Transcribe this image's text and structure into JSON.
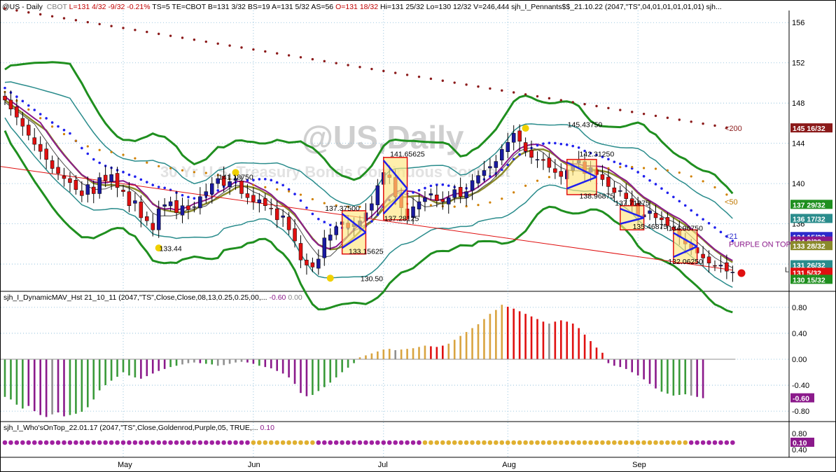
{
  "header": {
    "symbol": "@US - Daily",
    "exchange": "CBOT",
    "stats": [
      {
        "text": "L=131 4/32",
        "color": "r"
      },
      {
        "text": "-9/32",
        "color": "r"
      },
      {
        "text": "-0.21%",
        "color": "r"
      },
      {
        "text": "TS=5",
        "color": "k"
      },
      {
        "text": "TE=CBOT",
        "color": "k"
      },
      {
        "text": "B=131 3/32",
        "color": "k"
      },
      {
        "text": "BS=19",
        "color": "k"
      },
      {
        "text": "A=131 5/32",
        "color": "k"
      },
      {
        "text": "AS=56",
        "color": "k"
      },
      {
        "text": "O=131 18/32",
        "color": "r"
      },
      {
        "text": "Hi=131 25/32",
        "color": "k"
      },
      {
        "text": "Lo=130 12/32",
        "color": "k"
      },
      {
        "text": "V=246,444",
        "color": "k"
      },
      {
        "text": "sjh_I_Pennants$$_21.10.22 (2047,\"TS\",04,01,01,01,01,01)",
        "color": "k"
      },
      {
        "text": "sjh...",
        "color": "k"
      }
    ]
  },
  "watermark": {
    "title": "@US,Daily",
    "subtitle": "30 Yr U.S. Treasury Bonds Continuous Contract"
  },
  "panel2_header": {
    "name": "sjh_I_DynamicMAV_Hst 21_10_11 (2047,\"TS\",Close,Close,08,13,0.25,0.25,00,...",
    "v1": "-0.60",
    "v2": "0.00"
  },
  "panel3_header": {
    "name": "sjh_I_Who'sOnTop_22.01.17 (2047,\"TS\",Close,Goldenrod,Purple,05, TRUE,...",
    "v1": "0.10"
  },
  "chart_data": {
    "type": "candlestick",
    "price_axis": {
      "range": [
        129.5,
        157.2
      ],
      "ticks": [
        156,
        152,
        148,
        144,
        140,
        136,
        132
      ]
    },
    "histogram_axis": {
      "range": [
        -0.95,
        0.95
      ],
      "ticks": [
        "0.80",
        "0.40",
        "0.00",
        "-0.40",
        "-0.80"
      ]
    },
    "dots_axis": {
      "ticks": [
        "0.80",
        "0.40"
      ]
    },
    "x_labels": [
      {
        "label": "May",
        "index": 20
      },
      {
        "label": "Jun",
        "index": 42
      },
      {
        "label": "Jul",
        "index": 64
      },
      {
        "label": "Aug",
        "index": 85
      },
      {
        "label": "Sep",
        "index": 107
      }
    ],
    "closes": [
      148.3,
      147.4,
      146.6,
      145.7,
      144.8,
      143.9,
      143.2,
      142.4,
      141.5,
      141.0,
      140.5,
      140.1,
      139.4,
      138.8,
      139.9,
      139.0,
      140.6,
      140.3,
      140.9,
      139.6,
      139.2,
      137.8,
      138.3,
      136.6,
      136.3,
      135.4,
      137.5,
      137.9,
      138.2,
      137.1,
      137.8,
      137.4,
      137.7,
      138.7,
      139.2,
      140.0,
      140.5,
      139.8,
      140.2,
      140.5,
      139.0,
      138.6,
      138.2,
      138.4,
      137.8,
      137.5,
      136.4,
      136.8,
      135.4,
      134.3,
      132.4,
      131.9,
      131.7,
      132.5,
      134.6,
      134.9,
      135.7,
      136.2,
      135.6,
      136.0,
      136.3,
      137.1,
      138.0,
      139.8,
      141.1,
      140.6,
      138.7,
      137.6,
      136.5,
      137.7,
      138.2,
      138.6,
      139.0,
      138.3,
      138.2,
      138.6,
      139.4,
      138.7,
      139.2,
      140.3,
      140.8,
      141.3,
      141.7,
      142.2,
      143.4,
      144.1,
      145.0,
      144.2,
      143.2,
      142.6,
      142.4,
      142.3,
      141.6,
      141.1,
      140.7,
      141.3,
      141.8,
      142.3,
      141.0,
      141.6,
      140.9,
      140.4,
      139.7,
      139.1,
      139.3,
      138.5,
      137.8,
      136.8,
      136.9,
      137.3,
      136.6,
      136.4,
      135.8,
      135.4,
      134.7,
      134.0,
      133.4,
      133.1,
      132.6,
      132.1,
      131.8,
      131.9,
      131.3,
      131.2
    ],
    "histogram": [
      {
        "v": -0.58,
        "c": "g"
      },
      {
        "v": -0.62,
        "c": "g"
      },
      {
        "v": -0.7,
        "c": "g"
      },
      {
        "v": -0.76,
        "c": "g"
      },
      {
        "v": -0.72,
        "c": "p"
      },
      {
        "v": -0.8,
        "c": "p"
      },
      {
        "v": -0.86,
        "c": "p"
      },
      {
        "v": -0.89,
        "c": "p"
      },
      {
        "v": -0.85,
        "c": "x"
      },
      {
        "v": -0.82,
        "c": "p"
      },
      {
        "v": -0.88,
        "c": "p"
      },
      {
        "v": -0.86,
        "c": "g"
      },
      {
        "v": -0.84,
        "c": "g"
      },
      {
        "v": -0.81,
        "c": "g"
      },
      {
        "v": -0.74,
        "c": "g"
      },
      {
        "v": -0.62,
        "c": "g"
      },
      {
        "v": -0.48,
        "c": "g"
      },
      {
        "v": -0.4,
        "c": "g"
      },
      {
        "v": -0.33,
        "c": "g"
      },
      {
        "v": -0.27,
        "c": "g"
      },
      {
        "v": -0.2,
        "c": "g"
      },
      {
        "v": -0.25,
        "c": "g"
      },
      {
        "v": -0.28,
        "c": "g"
      },
      {
        "v": -0.3,
        "c": "p"
      },
      {
        "v": -0.26,
        "c": "p"
      },
      {
        "v": -0.22,
        "c": "p"
      },
      {
        "v": -0.18,
        "c": "p"
      },
      {
        "v": -0.15,
        "c": "p"
      },
      {
        "v": -0.12,
        "c": "g"
      },
      {
        "v": -0.1,
        "c": "g"
      },
      {
        "v": -0.08,
        "c": "x"
      },
      {
        "v": -0.06,
        "c": "x"
      },
      {
        "v": -0.05,
        "c": "x"
      },
      {
        "v": -0.06,
        "c": "p"
      },
      {
        "v": -0.07,
        "c": "g"
      },
      {
        "v": -0.08,
        "c": "g"
      },
      {
        "v": -0.1,
        "c": "x"
      },
      {
        "v": -0.09,
        "c": "x"
      },
      {
        "v": -0.07,
        "c": "x"
      },
      {
        "v": -0.05,
        "c": "x"
      },
      {
        "v": -0.04,
        "c": "x"
      },
      {
        "v": -0.05,
        "c": "p"
      },
      {
        "v": -0.07,
        "c": "p"
      },
      {
        "v": -0.1,
        "c": "g"
      },
      {
        "v": -0.12,
        "c": "p"
      },
      {
        "v": -0.14,
        "c": "p"
      },
      {
        "v": -0.18,
        "c": "p"
      },
      {
        "v": -0.22,
        "c": "p"
      },
      {
        "v": -0.28,
        "c": "p"
      },
      {
        "v": -0.38,
        "c": "p"
      },
      {
        "v": -0.52,
        "c": "p"
      },
      {
        "v": -0.57,
        "c": "p"
      },
      {
        "v": -0.55,
        "c": "g"
      },
      {
        "v": -0.49,
        "c": "g"
      },
      {
        "v": -0.43,
        "c": "g"
      },
      {
        "v": -0.36,
        "c": "g"
      },
      {
        "v": -0.28,
        "c": "g"
      },
      {
        "v": -0.2,
        "c": "g"
      },
      {
        "v": -0.13,
        "c": "g"
      },
      {
        "v": -0.06,
        "c": "g"
      },
      {
        "v": 0.03,
        "c": "o"
      },
      {
        "v": 0.06,
        "c": "o"
      },
      {
        "v": 0.09,
        "c": "o"
      },
      {
        "v": 0.12,
        "c": "o"
      },
      {
        "v": 0.15,
        "c": "o"
      },
      {
        "v": 0.16,
        "c": "o"
      },
      {
        "v": 0.14,
        "c": "x"
      },
      {
        "v": 0.15,
        "c": "o"
      },
      {
        "v": 0.16,
        "c": "o"
      },
      {
        "v": 0.17,
        "c": "o"
      },
      {
        "v": 0.19,
        "c": "o"
      },
      {
        "v": 0.21,
        "c": "o"
      },
      {
        "v": 0.2,
        "c": "r"
      },
      {
        "v": 0.19,
        "c": "r"
      },
      {
        "v": 0.21,
        "c": "r"
      },
      {
        "v": 0.24,
        "c": "o"
      },
      {
        "v": 0.3,
        "c": "o"
      },
      {
        "v": 0.36,
        "c": "o"
      },
      {
        "v": 0.42,
        "c": "o"
      },
      {
        "v": 0.48,
        "c": "o"
      },
      {
        "v": 0.54,
        "c": "o"
      },
      {
        "v": 0.62,
        "c": "o"
      },
      {
        "v": 0.7,
        "c": "o"
      },
      {
        "v": 0.76,
        "c": "o"
      },
      {
        "v": 0.84,
        "c": "o"
      },
      {
        "v": 0.81,
        "c": "r"
      },
      {
        "v": 0.78,
        "c": "r"
      },
      {
        "v": 0.74,
        "c": "r"
      },
      {
        "v": 0.7,
        "c": "r"
      },
      {
        "v": 0.66,
        "c": "r"
      },
      {
        "v": 0.62,
        "c": "r"
      },
      {
        "v": 0.58,
        "c": "r"
      },
      {
        "v": 0.55,
        "c": "x"
      },
      {
        "v": 0.58,
        "c": "r"
      },
      {
        "v": 0.6,
        "c": "r"
      },
      {
        "v": 0.58,
        "c": "r"
      },
      {
        "v": 0.55,
        "c": "r"
      },
      {
        "v": 0.48,
        "c": "r"
      },
      {
        "v": 0.38,
        "c": "r"
      },
      {
        "v": 0.28,
        "c": "r"
      },
      {
        "v": 0.18,
        "c": "r"
      },
      {
        "v": 0.1,
        "c": "r"
      },
      {
        "v": -0.06,
        "c": "p"
      },
      {
        "v": -0.1,
        "c": "p"
      },
      {
        "v": -0.12,
        "c": "p"
      },
      {
        "v": -0.15,
        "c": "p"
      },
      {
        "v": -0.2,
        "c": "p"
      },
      {
        "v": -0.25,
        "c": "p"
      },
      {
        "v": -0.31,
        "c": "p"
      },
      {
        "v": -0.38,
        "c": "p"
      },
      {
        "v": -0.45,
        "c": "p"
      },
      {
        "v": -0.5,
        "c": "g"
      },
      {
        "v": -0.53,
        "c": "g"
      },
      {
        "v": -0.56,
        "c": "g"
      },
      {
        "v": -0.55,
        "c": "g"
      },
      {
        "v": -0.54,
        "c": "g"
      },
      {
        "v": -0.56,
        "c": "x"
      },
      {
        "v": -0.58,
        "c": "p"
      },
      {
        "v": -0.6,
        "c": "p"
      }
    ],
    "dots_sequence": "PPPPPPPPPPPPPPPPPPPPPPPPPPPPPPPPPPPPPPPPPPGGGGGGGGGGGPPPPPPPPPPPPPPPPPPGGGGGGGGGGGGGGGGGGGGGGGGGGGGGGGGGGGGGGGGGGGGGPPPPPPPPPPPPPP",
    "annotations": [
      {
        "text": "141.18750",
        "price": 140.4,
        "index": 38
      },
      {
        "text": "133.44",
        "price": 133.3,
        "index": 28
      },
      {
        "text": "137.37500",
        "price": 137.3,
        "index": 56
      },
      {
        "text": "141.65625",
        "price": 142.7,
        "index": 67
      },
      {
        "text": "133.15625",
        "price": 133.0,
        "index": 60
      },
      {
        "text": "137.28125",
        "price": 136.3,
        "index": 66
      },
      {
        "text": "130.50",
        "price": 130.3,
        "index": 62
      },
      {
        "text": "145.43750",
        "price": 145.6,
        "index": 97
      },
      {
        "text": "142.31250",
        "price": 142.7,
        "index": 99
      },
      {
        "text": "138.96875",
        "price": 138.5,
        "index": 99
      },
      {
        "text": "137.71875",
        "price": 137.8,
        "index": 105
      },
      {
        "text": "135.46875",
        "price": 135.5,
        "index": 108
      },
      {
        "text": "134.96750",
        "price": 135.3,
        "index": 114
      },
      {
        "text": "132.06250",
        "price": 132.0,
        "index": 114
      }
    ],
    "right_tags": [
      {
        "text": "145 16/32",
        "price": 145.5,
        "bg": "#8b1a1a",
        "fg": "#ffffff"
      },
      {
        "text": "137 29/32",
        "price": 137.9,
        "bg": "#1f8f1f",
        "fg": "#ffffff"
      },
      {
        "text": "136 17/32",
        "price": 136.5,
        "bg": "#2a8c8c",
        "fg": "#ffffff"
      },
      {
        "text": "134 15/32",
        "price": 134.7,
        "bg": "#2b2bcc",
        "fg": "#ffffff"
      },
      {
        "text": "134 8/32",
        "price": 134.25,
        "bg": "#8b1a8b",
        "fg": "#ffffff"
      },
      {
        "text": "133 28/32",
        "price": 133.8,
        "bg": "#8a8a2a",
        "fg": "#ffffff"
      },
      {
        "text": "131 26/32",
        "price": 131.9,
        "bg": "#2a8c8c",
        "fg": "#ffffff"
      },
      {
        "text": "131 5/32",
        "price": 131.15,
        "bg": "#e01010",
        "fg": "#ffffff"
      },
      {
        "text": "130 15/32",
        "price": 130.45,
        "bg": "#1f8f1f",
        "fg": "#ffffff"
      }
    ],
    "ma_labels": [
      {
        "text": "<200",
        "price": 145.5,
        "color": "#8b1a1a"
      },
      {
        "text": "<50",
        "price": 138.2,
        "color": "#c07800"
      },
      {
        "text": "<21",
        "price": 134.8,
        "color": "#2b2bcc"
      },
      {
        "text": "PURPLE ON TOP",
        "price": 134.0,
        "color": "#8b1a8b"
      }
    ],
    "hist_tag": {
      "text": "-0.60",
      "bg": "#8b1a8b",
      "fg": "#ffffff"
    },
    "dots_tag": {
      "text": "0.10",
      "bg": "#8b1a8b",
      "fg": "#ffffff"
    },
    "l_marker": "L"
  }
}
